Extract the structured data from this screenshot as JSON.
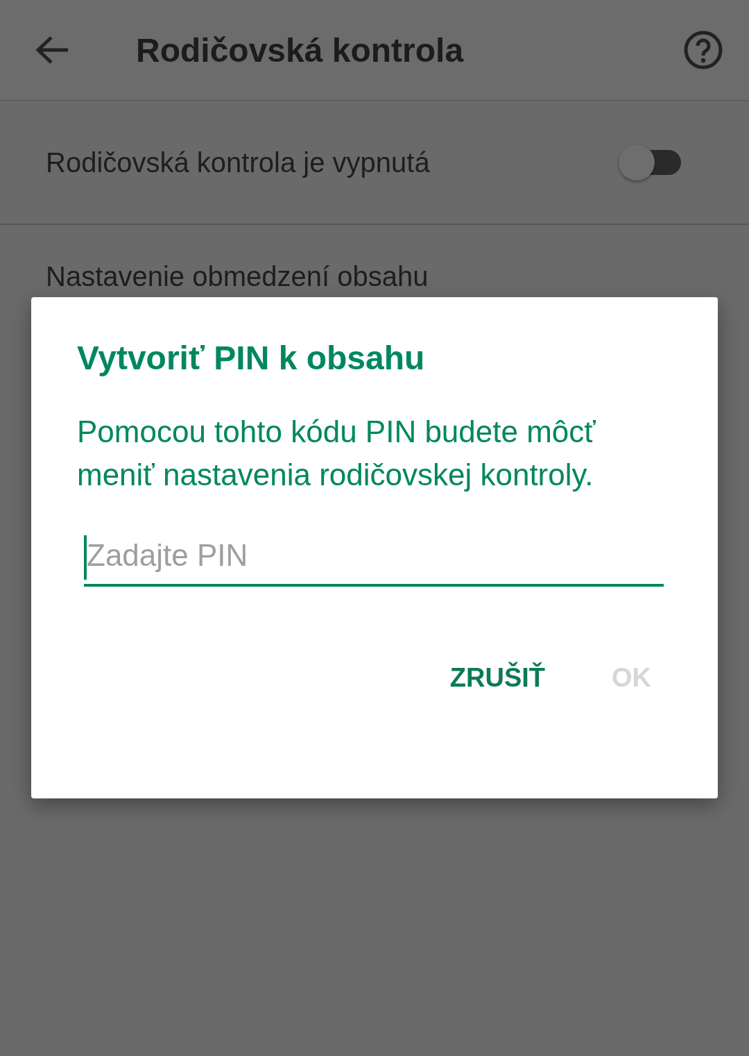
{
  "app_bar": {
    "title": "Rodičovská kontrola"
  },
  "settings": [
    {
      "kind": "toggle",
      "label": "Rodičovská kontrola je vypnutá",
      "on": false
    },
    {
      "kind": "text",
      "label": "Nastavenie obmedzení obsahu"
    }
  ],
  "dialog": {
    "title": "Vytvoriť PIN k obsahu",
    "message": "Pomocou tohto kódu PIN budete môcť meniť nastavenia rodičovskej kontroly.",
    "pin_field": {
      "placeholder": "Zadajte PIN",
      "focused": true
    },
    "buttons": [
      {
        "label": "ZRUŠIŤ",
        "disabled": false
      },
      {
        "label": "OK",
        "disabled": true
      }
    ]
  }
}
